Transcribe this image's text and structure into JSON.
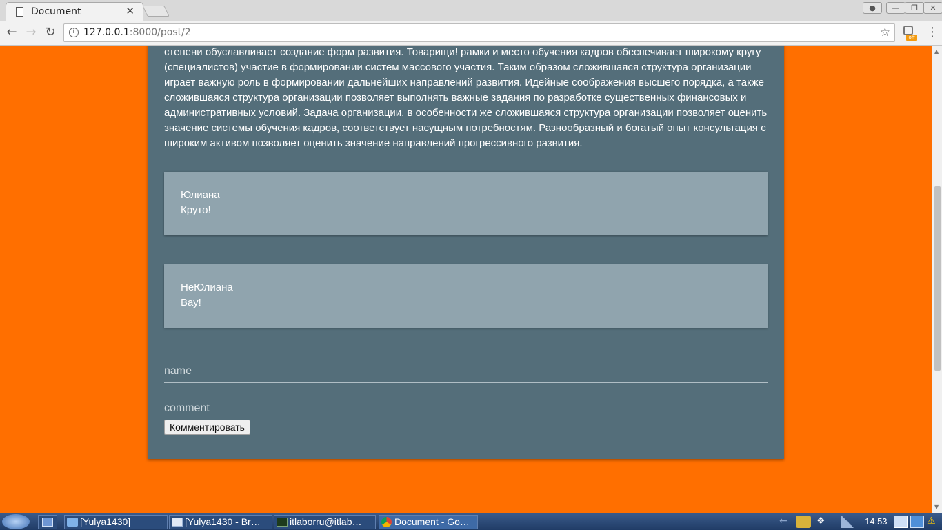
{
  "browser": {
    "tab_title": "Document",
    "tab_close": "✕",
    "url_host": "127.0.0.1",
    "url_rest": ":8000/post/2",
    "extension_badge": "off"
  },
  "post": {
    "body": "степени обуславливает создание форм развития. Товарищи! рамки и место обучения кадров обеспечивает широкому кругу (специалистов) участие в формировании систем массового участия. Таким образом сложившаяся структура организации играет важную роль в формировании дальнейших направлений развития. Идейные соображения высшего порядка, а также сложившаяся структура организации позволяет выполнять важные задания по разработке существенных финансовых и административных условий. Задача организации, в особенности же сложившаяся структура организации позволяет оценить значение системы обучения кадров, соответствует насущным потребностям. Разнообразный и богатый опыт консультация с широким активом позволяет оценить значение направлений прогрессивного развития."
  },
  "comments": [
    {
      "author": "Юлиана",
      "text": "Круто!"
    },
    {
      "author": "НеЮлиана",
      "text": "Вау!"
    }
  ],
  "form": {
    "name_placeholder": "name",
    "comment_placeholder": "comment",
    "submit_label": "Комментировать"
  },
  "taskbar": {
    "items": [
      {
        "label": "[Yulya1430]",
        "icon": "folder-icon"
      },
      {
        "label": "[Yulya1430 - Br…",
        "icon": "window-icon"
      },
      {
        "label": "itlaborru@itlab…",
        "icon": "terminal-icon"
      },
      {
        "label": "Document - Go…",
        "icon": "chrome-icon"
      }
    ],
    "clock": "14:53"
  }
}
